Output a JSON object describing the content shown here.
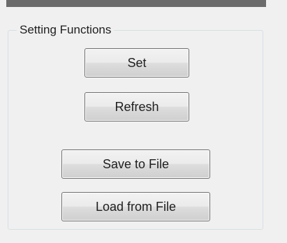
{
  "group": {
    "title": "Setting Functions"
  },
  "buttons": {
    "set": "Set",
    "refresh": "Refresh",
    "save_to_file": "Save to File",
    "load_from_file": "Load from File"
  }
}
